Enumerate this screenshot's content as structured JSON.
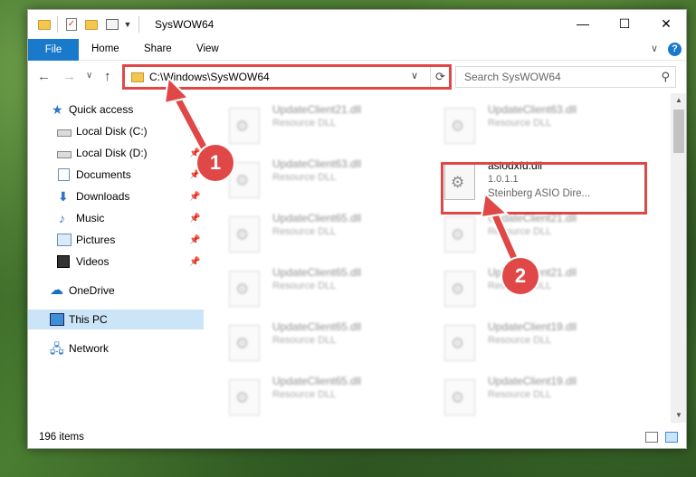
{
  "window": {
    "title": "SysWOW64",
    "controls": {
      "minimize": "—",
      "maximize": "☐",
      "close": "✕"
    }
  },
  "ribbon": {
    "tabs": [
      "File",
      "Home",
      "Share",
      "View"
    ],
    "expand": "∨",
    "help": "?"
  },
  "address": {
    "path": "C:\\Windows\\SysWOW64",
    "dropdown": "∨",
    "refresh": "⟳"
  },
  "nav": {
    "back": "←",
    "forward": "→",
    "recent": "∨",
    "up": "↑"
  },
  "search": {
    "placeholder": "Search SysWOW64",
    "icon": "⚲"
  },
  "sidebar": {
    "items": [
      {
        "label": "Quick access",
        "icon": "quick-access-star-icon",
        "pinned": false
      },
      {
        "label": "Local Disk (C:)",
        "icon": "drive-icon",
        "pinned": true
      },
      {
        "label": "Local Disk (D:)",
        "icon": "drive-icon",
        "pinned": true
      },
      {
        "label": "Documents",
        "icon": "documents-icon",
        "pinned": true
      },
      {
        "label": "Downloads",
        "icon": "downloads-icon",
        "pinned": true
      },
      {
        "label": "Music",
        "icon": "music-icon",
        "pinned": true
      },
      {
        "label": "Pictures",
        "icon": "pictures-icon",
        "pinned": true
      },
      {
        "label": "Videos",
        "icon": "videos-icon",
        "pinned": true
      },
      {
        "label": "OneDrive",
        "icon": "onedrive-icon",
        "pinned": false
      },
      {
        "label": "This PC",
        "icon": "this-pc-icon",
        "pinned": false,
        "selected": true
      },
      {
        "label": "Network",
        "icon": "network-icon",
        "pinned": false
      }
    ],
    "pin_glyph": "📌"
  },
  "files": [
    {
      "name": "UpdateClient21.dll",
      "type": "Resource DLL"
    },
    {
      "name": "UpdateClient63.dll",
      "type": "Resource DLL"
    },
    {
      "name": "UpdateClient63.dll",
      "type": "Resource DLL"
    },
    {
      "name": "asiodxfd.dll",
      "version": "1.0.1.1",
      "description": "Steinberg ASIO Dire...",
      "highlighted": true
    },
    {
      "name": "UpdateClient65.dll",
      "type": "Resource DLL"
    },
    {
      "name": "UpdateClient21.dll",
      "type": "Resource DLL"
    },
    {
      "name": "UpdateClient65.dll",
      "type": "Resource DLL"
    },
    {
      "name": "UpdateClient21.dll",
      "type": "Resource DLL"
    },
    {
      "name": "UpdateClient65.dll",
      "type": "Resource DLL"
    },
    {
      "name": "UpdateClient19.dll",
      "type": "Resource DLL"
    },
    {
      "name": "UpdateClient65.dll",
      "type": "Resource DLL"
    },
    {
      "name": "UpdateClient19.dll",
      "type": "Resource DLL"
    }
  ],
  "status": {
    "items": "196 items"
  },
  "annotations": {
    "step1": "1",
    "step2": "2",
    "color": "#e04848"
  }
}
